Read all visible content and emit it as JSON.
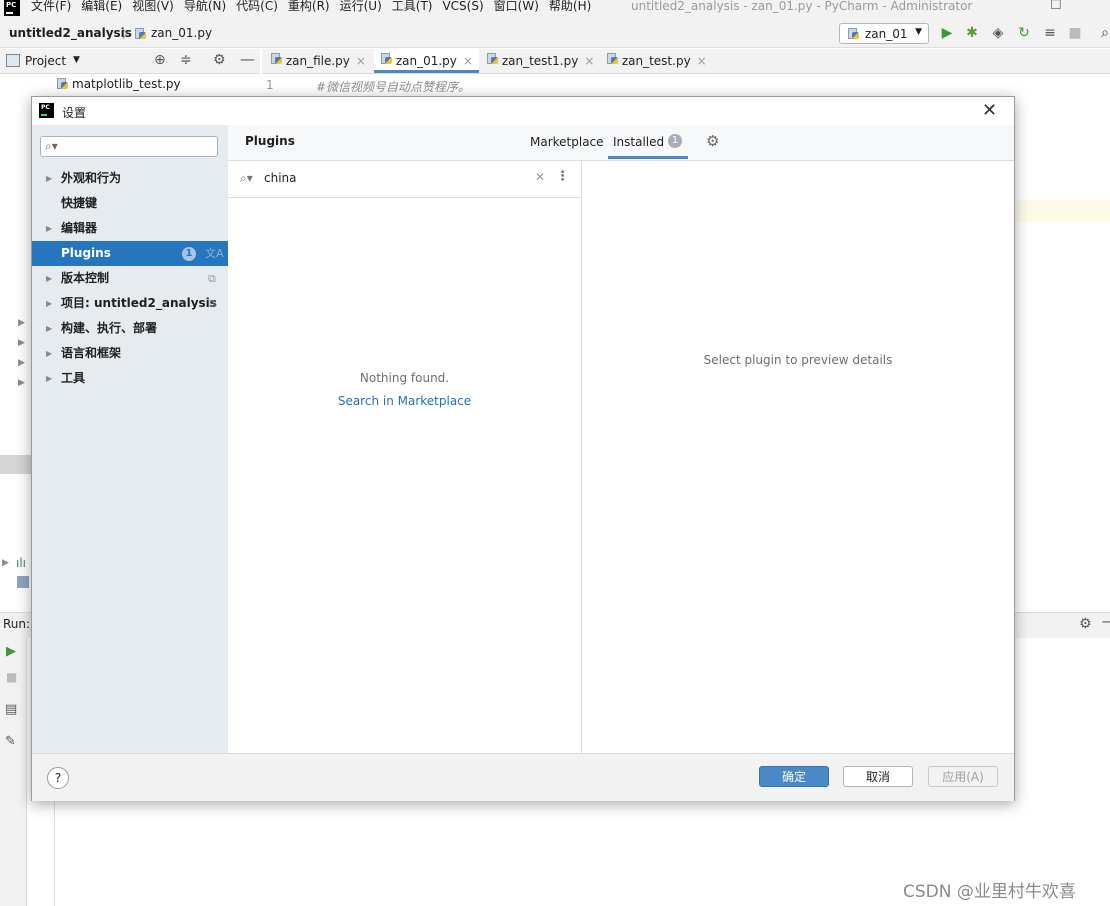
{
  "menubar": {
    "items": [
      "文件(F)",
      "编辑(E)",
      "视图(V)",
      "导航(N)",
      "代码(C)",
      "重构(R)",
      "运行(U)",
      "工具(T)",
      "VCS(S)",
      "窗口(W)",
      "帮助(H)"
    ],
    "window_title": "untitled2_analysis - zan_01.py - PyCharm - Administrator"
  },
  "navbar": {
    "project": "untitled2_analysis",
    "file": "zan_01.py",
    "run_config": "zan_01"
  },
  "project_panel": {
    "label": "Project",
    "tree_item": "matplotlib_test.py"
  },
  "editor": {
    "tabs": [
      "zan_file.py",
      "zan_01.py",
      "zan_test1.py",
      "zan_test.py"
    ],
    "active_tab": "zan_01.py",
    "line_number": "1",
    "line_text": "#微信视频号自动点赞程序。"
  },
  "run_panel": {
    "label": "Run:"
  },
  "dialog": {
    "title": "设置",
    "sidebar": [
      {
        "label": "外观和行为",
        "expandable": true
      },
      {
        "label": "快捷键",
        "expandable": false
      },
      {
        "label": "编辑器",
        "expandable": true
      },
      {
        "label": "Plugins",
        "expandable": false,
        "selected": true,
        "badge": "1"
      },
      {
        "label": "版本控制",
        "expandable": true
      },
      {
        "label": "项目: untitled2_analysis",
        "expandable": true
      },
      {
        "label": "构建、执行、部署",
        "expandable": true
      },
      {
        "label": "语言和框架",
        "expandable": true
      },
      {
        "label": "工具",
        "expandable": true
      }
    ],
    "plugins": {
      "heading": "Plugins",
      "tab_marketplace": "Marketplace",
      "tab_installed": "Installed",
      "installed_count": "1",
      "search_value": "china",
      "empty_text": "Nothing found.",
      "search_marketplace_link": "Search in Marketplace",
      "preview_text": "Select plugin to preview details"
    },
    "buttons": {
      "help": "?",
      "ok": "确定",
      "cancel": "取消",
      "apply": "应用(A)"
    }
  },
  "watermark": "CSDN @业里村牛欢喜",
  "colors": {
    "accent": "#4a88c7",
    "selection": "#2675bf",
    "sidebar_bg": "#e6ebf0",
    "link": "#2470b3"
  }
}
